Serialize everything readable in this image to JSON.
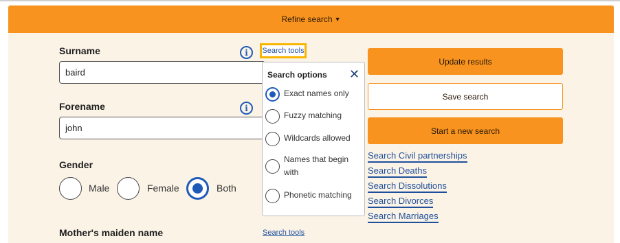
{
  "refine": {
    "label": "Refine search",
    "chevron_icon": "chevron-down-icon"
  },
  "surname": {
    "label": "Surname",
    "value": "baird",
    "search_tools": "Search tools"
  },
  "forename": {
    "label": "Forename",
    "value": "john"
  },
  "gender": {
    "label": "Gender",
    "options": [
      {
        "label": "Male",
        "selected": false
      },
      {
        "label": "Female",
        "selected": false
      },
      {
        "label": "Both",
        "selected": true
      }
    ]
  },
  "mothers_maiden_name": {
    "label": "Mother's maiden name",
    "search_tools": "Search tools"
  },
  "search_options": {
    "title": "Search options",
    "close_icon": "close-icon",
    "options": [
      {
        "label": "Exact names only",
        "selected": true
      },
      {
        "label": "Fuzzy matching",
        "selected": false
      },
      {
        "label": "Wildcards allowed",
        "selected": false
      },
      {
        "label": "Names that begin with",
        "selected": false
      },
      {
        "label": "Phonetic matching",
        "selected": false
      }
    ]
  },
  "actions": {
    "update": "Update results",
    "save": "Save search",
    "new": "Start a new search"
  },
  "links": [
    "Search Civil partnerships",
    "Search Deaths",
    "Search Dissolutions",
    "Search Divorces",
    "Search Marriages"
  ],
  "colors": {
    "accent": "#f7931e",
    "link": "#1e4f9c",
    "radio": "#1e5bb8",
    "highlight": "#f7b500",
    "panel": "#fbf3e6"
  }
}
